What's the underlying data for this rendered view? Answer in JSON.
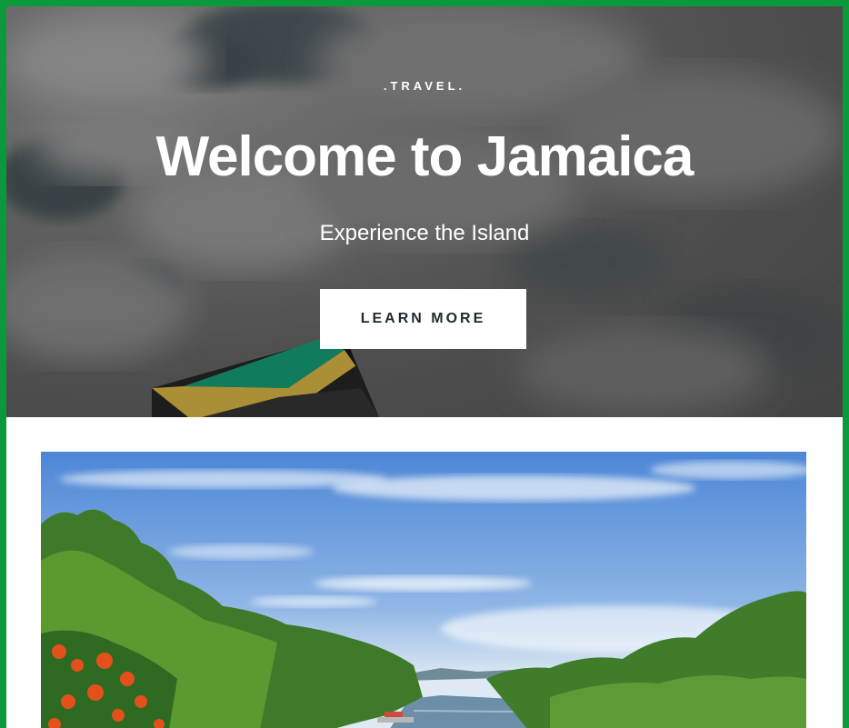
{
  "hero": {
    "kicker": ".TRAVEL.",
    "title": "Welcome to Jamaica",
    "subtitle": "Experience the Island",
    "cta_label": "LEARN MORE"
  },
  "colors": {
    "frame_border": "#0a9a3c",
    "flag_green": "#0d8f6a",
    "flag_gold": "#c9a63a",
    "flag_black": "#1c1c1c",
    "sky_blue": "#4d86d6"
  }
}
